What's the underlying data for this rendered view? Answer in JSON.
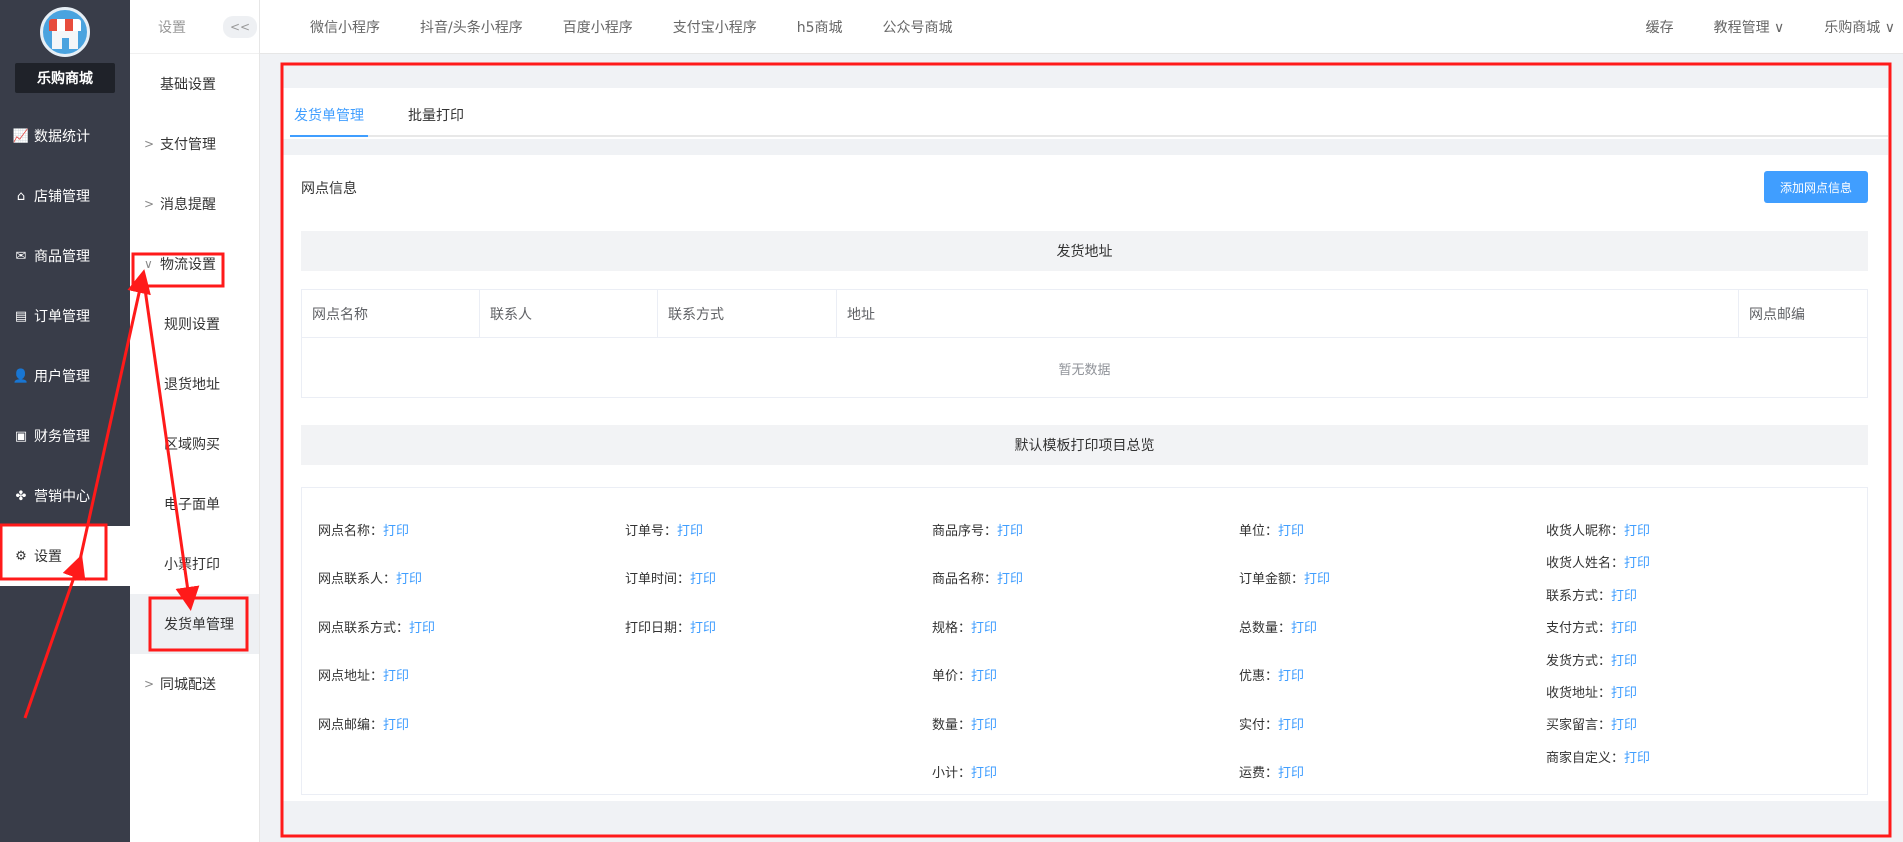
{
  "brand": {
    "name": "乐购商城"
  },
  "nav": [
    {
      "label": "数据统计",
      "icon": "line-chart-icon",
      "glyph": "📈"
    },
    {
      "label": "店铺管理",
      "icon": "store-icon",
      "glyph": "⌂"
    },
    {
      "label": "商品管理",
      "icon": "mail-icon",
      "glyph": "✉"
    },
    {
      "label": "订单管理",
      "icon": "order-icon",
      "glyph": "▤"
    },
    {
      "label": "用户管理",
      "icon": "user-icon",
      "glyph": "👤"
    },
    {
      "label": "财务管理",
      "icon": "finance-icon",
      "glyph": "▣"
    },
    {
      "label": "营销中心",
      "icon": "marketing-icon",
      "glyph": "✤"
    },
    {
      "label": "设置",
      "icon": "gear-icon",
      "glyph": "⚙"
    }
  ],
  "subnav": {
    "title": "设置",
    "collapse": "<<",
    "items": [
      {
        "label": "基础设置"
      },
      {
        "label": "支付管理",
        "arrow": ">"
      },
      {
        "label": "消息提醒",
        "arrow": ">"
      },
      {
        "label": "物流设置",
        "arrow": "∨"
      },
      {
        "label": "规则设置"
      },
      {
        "label": "退货地址"
      },
      {
        "label": "区域购买"
      },
      {
        "label": "电子面单"
      },
      {
        "label": "小票打印"
      },
      {
        "label": "发货单管理"
      },
      {
        "label": "同城配送",
        "arrow": ">"
      }
    ]
  },
  "topbar": {
    "tabs": [
      "微信小程序",
      "抖音/头条小程序",
      "百度小程序",
      "支付宝小程序",
      "h5商城",
      "公众号商城"
    ],
    "right": [
      "缓存",
      "教程管理 ∨",
      "乐购商城 ∨"
    ]
  },
  "page": {
    "tabs": [
      "发货单管理",
      "批量打印"
    ],
    "section_title": "网点信息",
    "add_button": "添加网点信息",
    "address_title": "发货地址",
    "table": {
      "headers": [
        "网点名称",
        "联系人",
        "联系方式",
        "地址",
        "网点邮编"
      ],
      "empty_text": "暂无数据"
    },
    "preview_title": "默认模板打印项目总览",
    "print_link": "打印",
    "columns": [
      [
        "网点名称：",
        "网点联系人：",
        "网点联系方式：",
        "网点地址：",
        "网点邮编："
      ],
      [
        "订单号：",
        "订单时间：",
        "打印日期："
      ],
      [
        "商品序号：",
        "商品名称：",
        "规格：",
        "单价：",
        "数量：",
        "小计："
      ],
      [
        "单位：",
        "订单金额：",
        "总数量：",
        "优惠：",
        "实付：",
        "运费："
      ],
      [
        "收货人昵称：",
        "收货人姓名：",
        "联系方式：",
        "支付方式：",
        "发货方式：",
        "收货地址：",
        "买家留言：",
        "商家自定义："
      ]
    ]
  },
  "colors": {
    "accent": "#409eff",
    "annotation": "#ff0000",
    "sidebar": "#393d49"
  }
}
